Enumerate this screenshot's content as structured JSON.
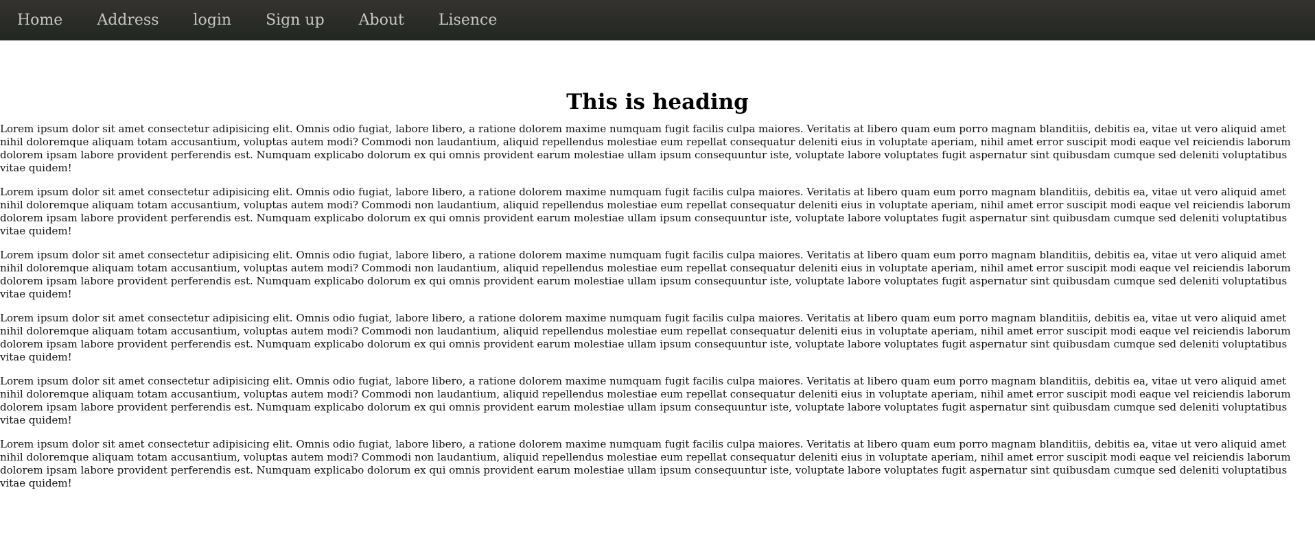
{
  "nav": {
    "items": [
      {
        "label": "Home"
      },
      {
        "label": "Address"
      },
      {
        "label": "login"
      },
      {
        "label": "Sign up"
      },
      {
        "label": "About"
      },
      {
        "label": "Lisence"
      }
    ]
  },
  "main": {
    "heading": "This is heading",
    "paragraphs": [
      {
        "text": "Lorem ipsum dolor sit amet consectetur adipisicing elit. Omnis odio fugiat, labore libero, a ratione dolorem maxime numquam fugit facilis culpa maiores. Veritatis at libero quam eum porro magnam blanditiis, debitis ea, vitae ut vero aliquid amet nihil doloremque aliquam totam accusantium, voluptas autem modi? Commodi non laudantium, aliquid repellendus molestiae eum repellat consequatur deleniti eius in voluptate aperiam, nihil amet error suscipit modi eaque vel reiciendis laborum dolorem ipsam labore provident perferendis est. Numquam explicabo dolorum ex qui omnis provident earum molestiae ullam ipsum consequuntur iste, voluptate labore voluptates fugit aspernatur sint quibusdam cumque sed deleniti voluptatibus vitae quidem!"
      },
      {
        "text": "Lorem ipsum dolor sit amet consectetur adipisicing elit. Omnis odio fugiat, labore libero, a ratione dolorem maxime numquam fugit facilis culpa maiores. Veritatis at libero quam eum porro magnam blanditiis, debitis ea, vitae ut vero aliquid amet nihil doloremque aliquam totam accusantium, voluptas autem modi? Commodi non laudantium, aliquid repellendus molestiae eum repellat consequatur deleniti eius in voluptate aperiam, nihil amet error suscipit modi eaque vel reiciendis laborum dolorem ipsam labore provident perferendis est. Numquam explicabo dolorum ex qui omnis provident earum molestiae ullam ipsum consequuntur iste, voluptate labore voluptates fugit aspernatur sint quibusdam cumque sed deleniti voluptatibus vitae quidem!"
      },
      {
        "text": "Lorem ipsum dolor sit amet consectetur adipisicing elit. Omnis odio fugiat, labore libero, a ratione dolorem maxime numquam fugit facilis culpa maiores. Veritatis at libero quam eum porro magnam blanditiis, debitis ea, vitae ut vero aliquid amet nihil doloremque aliquam totam accusantium, voluptas autem modi? Commodi non laudantium, aliquid repellendus molestiae eum repellat consequatur deleniti eius in voluptate aperiam, nihil amet error suscipit modi eaque vel reiciendis laborum dolorem ipsam labore provident perferendis est. Numquam explicabo dolorum ex qui omnis provident earum molestiae ullam ipsum consequuntur iste, voluptate labore voluptates fugit aspernatur sint quibusdam cumque sed deleniti voluptatibus vitae quidem!"
      },
      {
        "text": "Lorem ipsum dolor sit amet consectetur adipisicing elit. Omnis odio fugiat, labore libero, a ratione dolorem maxime numquam fugit facilis culpa maiores. Veritatis at libero quam eum porro magnam blanditiis, debitis ea, vitae ut vero aliquid amet nihil doloremque aliquam totam accusantium, voluptas autem modi? Commodi non laudantium, aliquid repellendus molestiae eum repellat consequatur deleniti eius in voluptate aperiam, nihil amet error suscipit modi eaque vel reiciendis laborum dolorem ipsam labore provident perferendis est. Numquam explicabo dolorum ex qui omnis provident earum molestiae ullam ipsum consequuntur iste, voluptate labore voluptates fugit aspernatur sint quibusdam cumque sed deleniti voluptatibus vitae quidem!"
      },
      {
        "text": "Lorem ipsum dolor sit amet consectetur adipisicing elit. Omnis odio fugiat, labore libero, a ratione dolorem maxime numquam fugit facilis culpa maiores. Veritatis at libero quam eum porro magnam blanditiis, debitis ea, vitae ut vero aliquid amet nihil doloremque aliquam totam accusantium, voluptas autem modi? Commodi non laudantium, aliquid repellendus molestiae eum repellat consequatur deleniti eius in voluptate aperiam, nihil amet error suscipit modi eaque vel reiciendis laborum dolorem ipsam labore provident perferendis est. Numquam explicabo dolorum ex qui omnis provident earum molestiae ullam ipsum consequuntur iste, voluptate labore voluptates fugit aspernatur sint quibusdam cumque sed deleniti voluptatibus vitae quidem!"
      },
      {
        "text": "Lorem ipsum dolor sit amet consectetur adipisicing elit. Omnis odio fugiat, labore libero, a ratione dolorem maxime numquam fugit facilis culpa maiores. Veritatis at libero quam eum porro magnam blanditiis, debitis ea, vitae ut vero aliquid amet nihil doloremque aliquam totam accusantium, voluptas autem modi? Commodi non laudantium, aliquid repellendus molestiae eum repellat consequatur deleniti eius in voluptate aperiam, nihil amet error suscipit modi eaque vel reiciendis laborum dolorem ipsam labore provident perferendis est. Numquam explicabo dolorum ex qui omnis provident earum molestiae ullam ipsum consequuntur iste, voluptate labore voluptates fugit aspernatur sint quibusdam cumque sed deleniti voluptatibus vitae quidem!"
      }
    ]
  },
  "colors": {
    "nav_background": "#2b2d28",
    "nav_text": "#c8c6c0",
    "page_background": "#ffffff",
    "text": "#111111"
  }
}
